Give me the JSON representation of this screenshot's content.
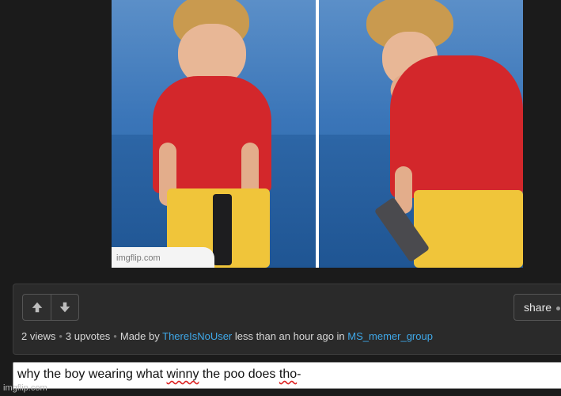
{
  "meme": {
    "watermark": "imgflip.com"
  },
  "info": {
    "views": "2 views",
    "upvotes": "3 upvotes",
    "made_by_prefix": "Made by",
    "author": "ThereIsNoUser",
    "time": "less than an hour ago in",
    "stream": "MS_memer_group",
    "share_label": "share"
  },
  "comment": {
    "before": "why the boy wearing what ",
    "word1": "winny",
    "middle": " the poo does ",
    "word2": "tho",
    "after": "-"
  },
  "footer": {
    "site": "imgflip.com"
  },
  "colors": {
    "link": "#3fa8e8",
    "background": "#1b1b1b",
    "panel": "#2a2a2a"
  }
}
